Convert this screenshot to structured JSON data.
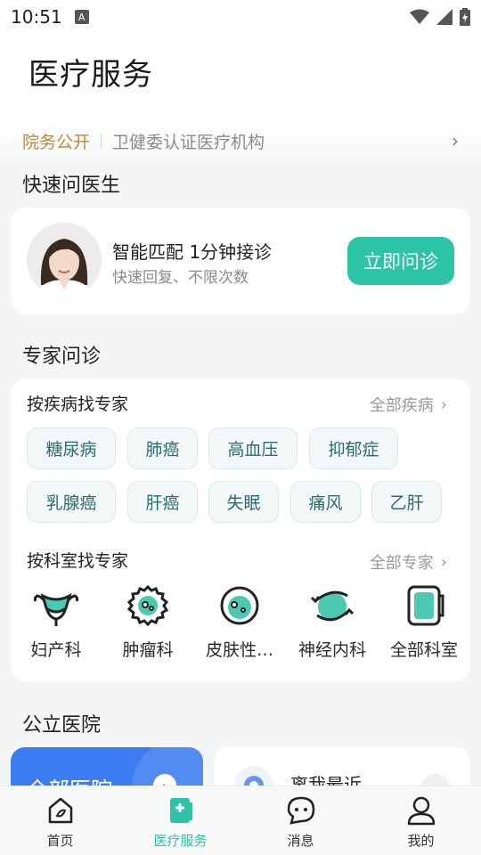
{
  "status_bar": {
    "time": "10:51",
    "notification_icon": "A"
  },
  "header": {
    "title": "医疗服务"
  },
  "notice": {
    "tag": "院务公开",
    "text": "卫健委认证医疗机构"
  },
  "quick_consult": {
    "section_title": "快速问医生",
    "title": "智能匹配 1分钟接诊",
    "subtitle": "快速回复、不限次数",
    "button": "立即问诊"
  },
  "expert": {
    "section_title": "专家问诊",
    "by_disease": {
      "title": "按疾病找专家",
      "more": "全部疾病",
      "tags": [
        "糖尿病",
        "肺癌",
        "高血压",
        "抑郁症",
        "乳腺癌",
        "肝癌",
        "失眠",
        "痛风",
        "乙肝"
      ]
    },
    "by_department": {
      "title": "按科室找专家",
      "more": "全部专家",
      "departments": [
        {
          "label": "妇产科",
          "icon": "uterus-icon"
        },
        {
          "label": "肿瘤科",
          "icon": "tumor-cell-icon"
        },
        {
          "label": "皮肤性…",
          "icon": "skin-icon"
        },
        {
          "label": "神经内科",
          "icon": "brain-icon"
        },
        {
          "label": "全部科室",
          "icon": "all-departments-icon"
        }
      ]
    }
  },
  "hospitals": {
    "section_title": "公立医院",
    "all_label": "全部医院",
    "nearby_label": "离我最近"
  },
  "tabbar": {
    "items": [
      {
        "label": "首页",
        "icon": "home-icon"
      },
      {
        "label": "医疗服务",
        "icon": "medical-service-icon"
      },
      {
        "label": "消息",
        "icon": "message-icon"
      },
      {
        "label": "我的",
        "icon": "user-icon"
      }
    ],
    "active_index": 1
  },
  "colors": {
    "accent": "#2dc3a6",
    "notice_tag": "#b98a3e",
    "hospital_blue": "#3b7cf0"
  }
}
